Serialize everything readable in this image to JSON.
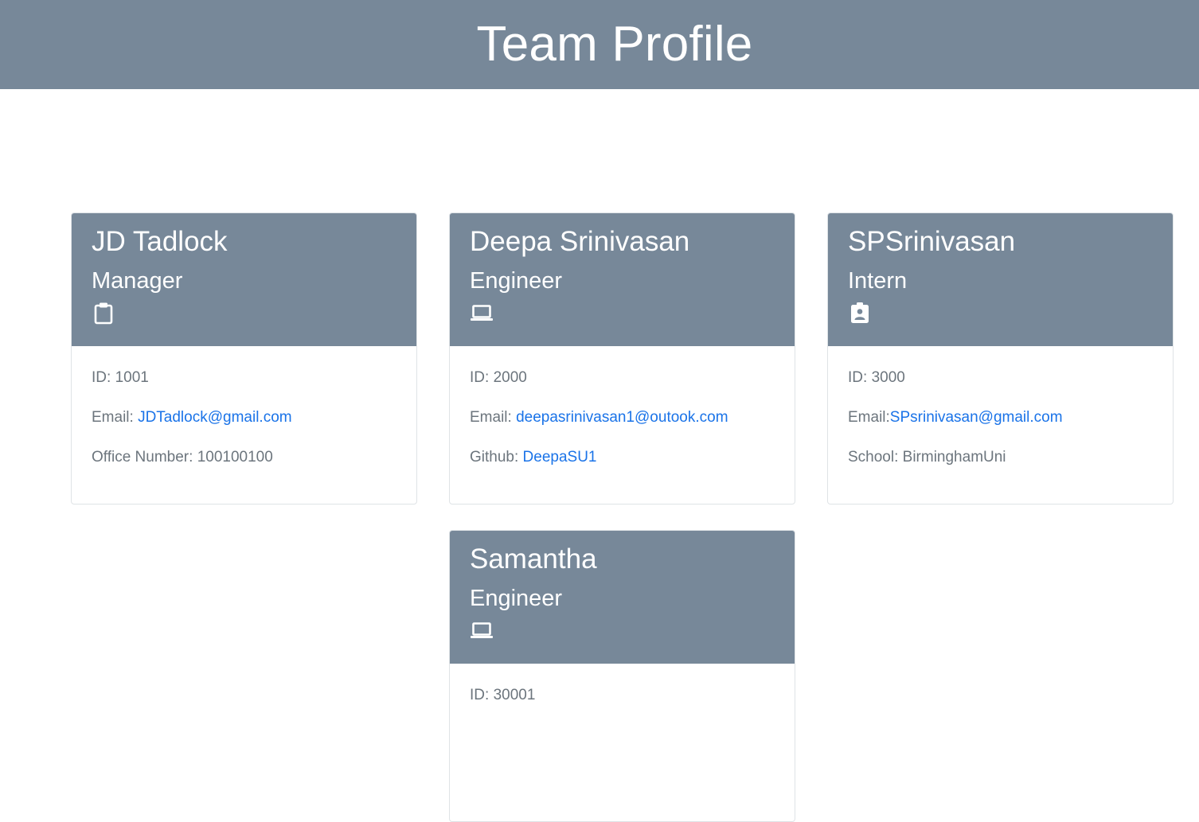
{
  "page": {
    "title": "Team Profile"
  },
  "colors": {
    "header_bg": "#778899",
    "link": "#1a73e8",
    "body_text": "#6c757d"
  },
  "cards": [
    {
      "name": "JD Tadlock",
      "role": "Manager",
      "icon": "clipboard-icon",
      "id_label": "ID: ",
      "id_value": "1001",
      "email_label": "Email: ",
      "email": "JDTadlock@gmail.com",
      "extra_label": "Office Number: ",
      "extra_value": "100100100"
    },
    {
      "name": "Deepa Srinivasan",
      "role": "Engineer",
      "icon": "laptop-icon",
      "id_label": "ID: ",
      "id_value": "2000",
      "email_label": "Email: ",
      "email": "deepasrinivasan1@outook.com",
      "extra_label": "Github: ",
      "extra_value": "DeepaSU1"
    },
    {
      "name": "SPSrinivasan",
      "role": "Intern",
      "icon": "id-badge-icon",
      "id_label": "ID: ",
      "id_value": "3000",
      "email_label": "Email:",
      "email": "SPsrinivasan@gmail.com",
      "extra_label": "School: ",
      "extra_value": "BirminghamUni"
    },
    {
      "name": "Samantha",
      "role": "Engineer",
      "icon": "laptop-icon",
      "id_label": "ID: ",
      "id_value": "30001"
    }
  ]
}
